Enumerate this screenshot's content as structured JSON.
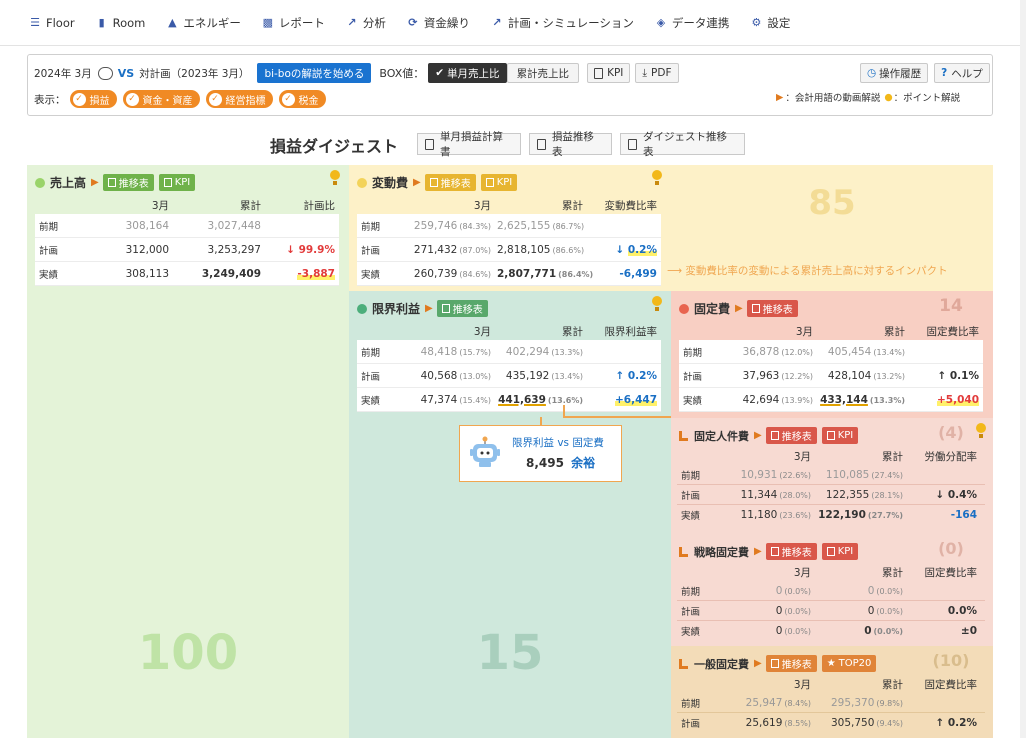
{
  "nav": {
    "items": [
      {
        "label": "Floor",
        "icon": "list-icon"
      },
      {
        "label": "Room",
        "icon": "door-icon"
      },
      {
        "label": "エネルギー",
        "icon": "energy-icon"
      },
      {
        "label": "レポート",
        "icon": "bar-chart-icon"
      },
      {
        "label": "分析",
        "icon": "line-chart-icon"
      },
      {
        "label": "資金繰り",
        "icon": "money-cycle-icon"
      },
      {
        "label": "計画・シミュレーション",
        "icon": "plan-chart-icon"
      },
      {
        "label": "データ連携",
        "icon": "data-link-icon"
      },
      {
        "label": "設定",
        "icon": "gear-icon"
      }
    ]
  },
  "filter": {
    "period": "2024年 3月",
    "vs": "VS",
    "compare": "対計画（2023年 3月）",
    "start_guide": "bi-boの解説を始める",
    "box_label": "BOX値：",
    "box_monthly": "単月売上比",
    "box_cumulative": "累計売上比",
    "kpi": "KPI",
    "pdf": "PDF",
    "history": "操作履歴",
    "help": "ヘルプ",
    "display_label": "表示：",
    "chips": [
      "損益",
      "資金・資産",
      "経営指標",
      "税金"
    ],
    "legend_video": "：会計用語の動画解説",
    "legend_point": "：ポイント解説"
  },
  "heading": {
    "title": "損益ダイジェスト",
    "btn1": "単月損益計算書",
    "btn2": "損益推移表",
    "btn3": "ダイジェスト推移表"
  },
  "common": {
    "month": "3月",
    "cumulative": "累計",
    "trend": "推移表",
    "kpi": "KPI",
    "top20": "TOP20",
    "row_prev": "前期",
    "row_plan": "計画",
    "row_actual": "実績"
  },
  "sales": {
    "title": "売上高",
    "ratio_header": "計画比",
    "prev": [
      "308,164",
      "3,027,448",
      ""
    ],
    "plan": [
      "312,000",
      "3,253,297",
      "99.9%"
    ],
    "actual": [
      "308,113",
      "3,249,409",
      "-3,887"
    ],
    "score": "100"
  },
  "variable": {
    "title": "変動費",
    "ratio_header": "変動費比率",
    "prev": [
      "259,746",
      "(84.3%)",
      "2,625,155",
      "(86.7%)",
      ""
    ],
    "plan": [
      "271,432",
      "(87.0%)",
      "2,818,105",
      "(86.6%)",
      "0.2%"
    ],
    "actual": [
      "260,739",
      "(84.6%)",
      "2,807,771",
      "(86.4%)",
      "-6,499"
    ],
    "score": "85",
    "note": "変動費比率の変動による累計売上高に対するインパクト"
  },
  "margin": {
    "title": "限界利益",
    "ratio_header": "限界利益率",
    "prev": [
      "48,418",
      "(15.7%)",
      "402,294",
      "(13.3%)",
      ""
    ],
    "plan": [
      "40,568",
      "(13.0%)",
      "435,192",
      "(13.4%)",
      "0.2%"
    ],
    "actual": [
      "47,374",
      "(15.4%)",
      "441,639",
      "(13.6%)",
      "+6,447"
    ],
    "score": "15",
    "tooltip_title": "限界利益 vs 固定費",
    "tooltip_value": "8,495",
    "tooltip_suffix": "余裕"
  },
  "fixed": {
    "title": "固定費",
    "ratio_header": "固定費比率",
    "prev": [
      "36,878",
      "(12.0%)",
      "405,454",
      "(13.4%)",
      ""
    ],
    "plan": [
      "37,963",
      "(12.2%)",
      "428,104",
      "(13.2%)",
      "0.1%"
    ],
    "actual": [
      "42,694",
      "(13.9%)",
      "433,144",
      "(13.3%)",
      "+5,040"
    ],
    "score": "14"
  },
  "labor": {
    "title": "固定人件費",
    "ratio_header": "労働分配率",
    "prev": [
      "10,931",
      "(22.6%)",
      "110,085",
      "(27.4%)",
      ""
    ],
    "plan": [
      "11,344",
      "(28.0%)",
      "122,355",
      "(28.1%)",
      "0.4%"
    ],
    "actual": [
      "11,180",
      "(23.6%)",
      "122,190",
      "(27.7%)",
      "-164"
    ],
    "score": "(4)"
  },
  "strategic": {
    "title": "戦略固定費",
    "ratio_header": "固定費比率",
    "prev": [
      "0",
      "(0.0%)",
      "0",
      "(0.0%)",
      ""
    ],
    "plan": [
      "0",
      "(0.0%)",
      "0",
      "(0.0%)",
      "0.0%"
    ],
    "actual": [
      "0",
      "(0.0%)",
      "0",
      "(0.0%)",
      "±0"
    ],
    "score": "(0)"
  },
  "general": {
    "title": "一般固定費",
    "ratio_header": "固定費比率",
    "prev": [
      "25,947",
      "(8.4%)",
      "295,370",
      "(9.8%)",
      ""
    ],
    "plan": [
      "25,619",
      "(8.5%)",
      "305,750",
      "(9.4%)",
      "0.2%"
    ],
    "score": "(10)"
  }
}
